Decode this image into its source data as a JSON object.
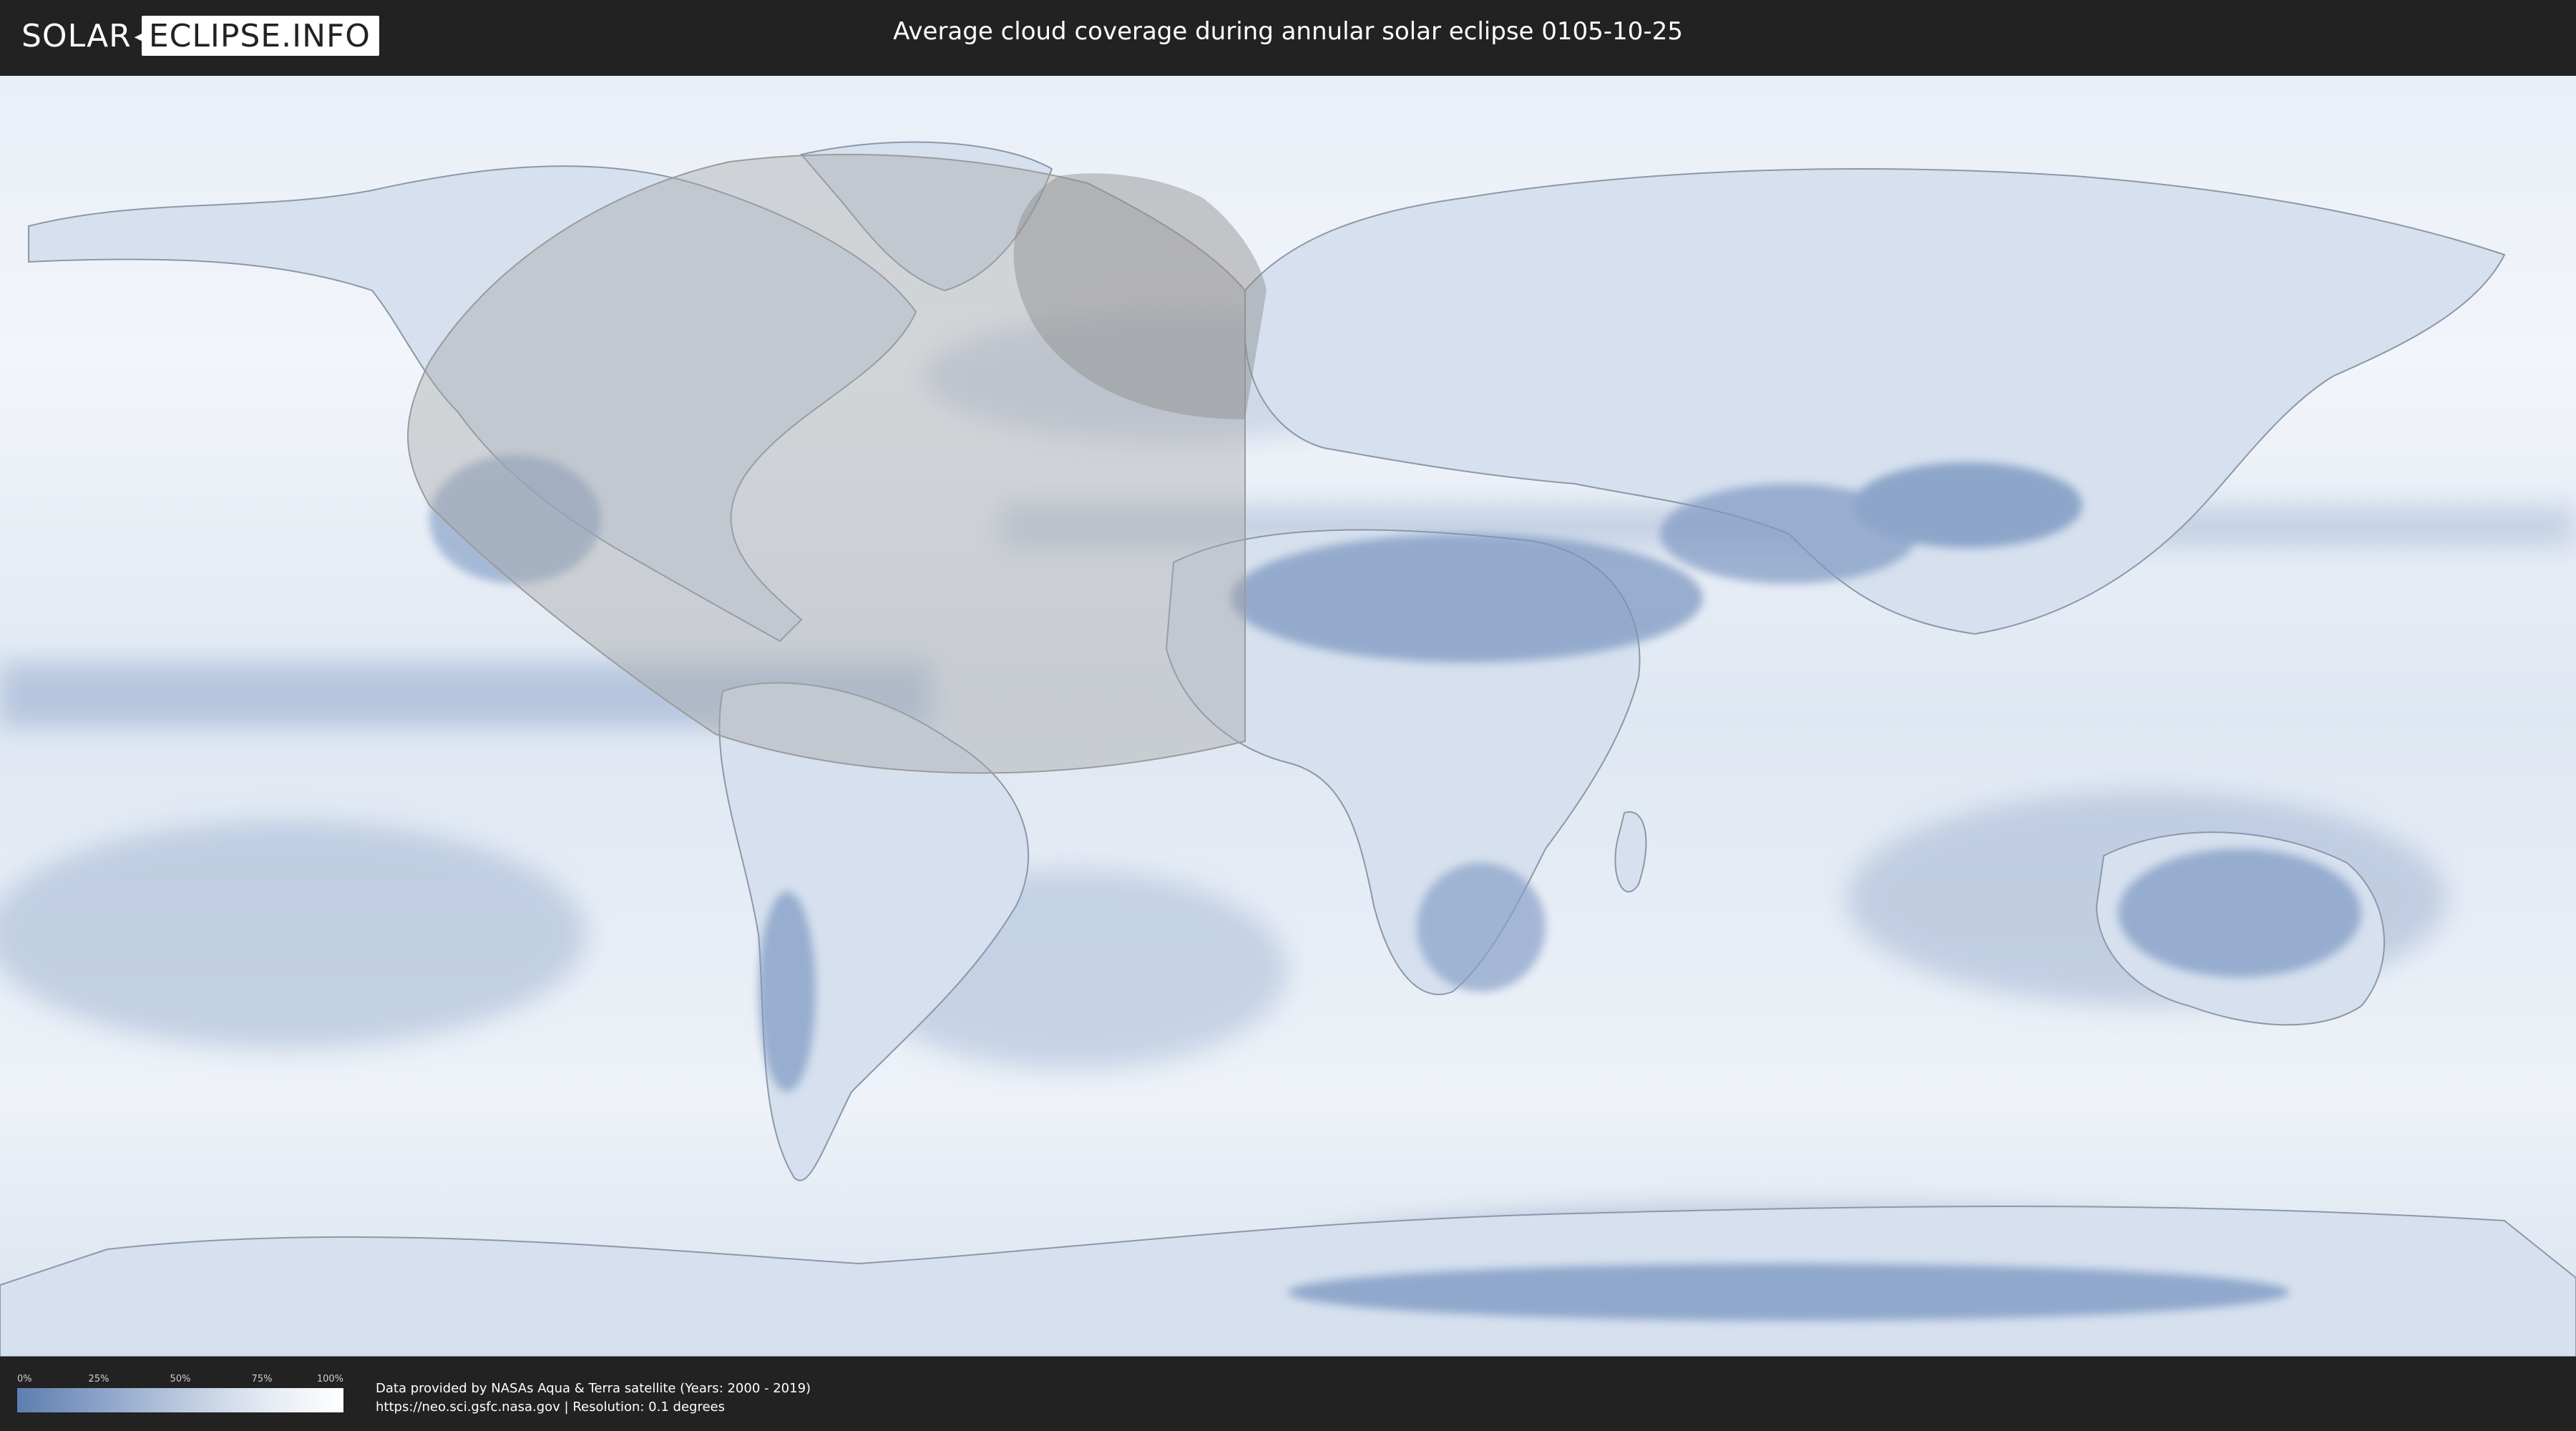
{
  "header": {
    "logo_left": "SOLAR",
    "logo_separator": "◂",
    "logo_right": "ECLIPSE.INFO",
    "title": "Average cloud coverage during annular solar eclipse 0105-10-25"
  },
  "map": {
    "kind": "world cloud coverage map",
    "projection": "equirectangular",
    "colors": {
      "ocean_clear": "#6f8fbd",
      "cloud": "#f4f7fb",
      "land_clear": "#5c7fb3",
      "eclipse_shadow": "#9a9a9a"
    },
    "icons": [
      "solar-eclipse-logo-icon"
    ]
  },
  "legend": {
    "ticks": [
      "0%",
      "25%",
      "50%",
      "75%",
      "100%"
    ],
    "gradient_from": "#5e7eaf",
    "gradient_to": "#ffffff"
  },
  "footer": {
    "credit_line1": "Data provided by NASAs Aqua & Terra satellite (Years: 2000 - 2019)",
    "credit_line2": "https://neo.sci.gsfc.nasa.gov | Resolution: 0.1 degrees"
  }
}
